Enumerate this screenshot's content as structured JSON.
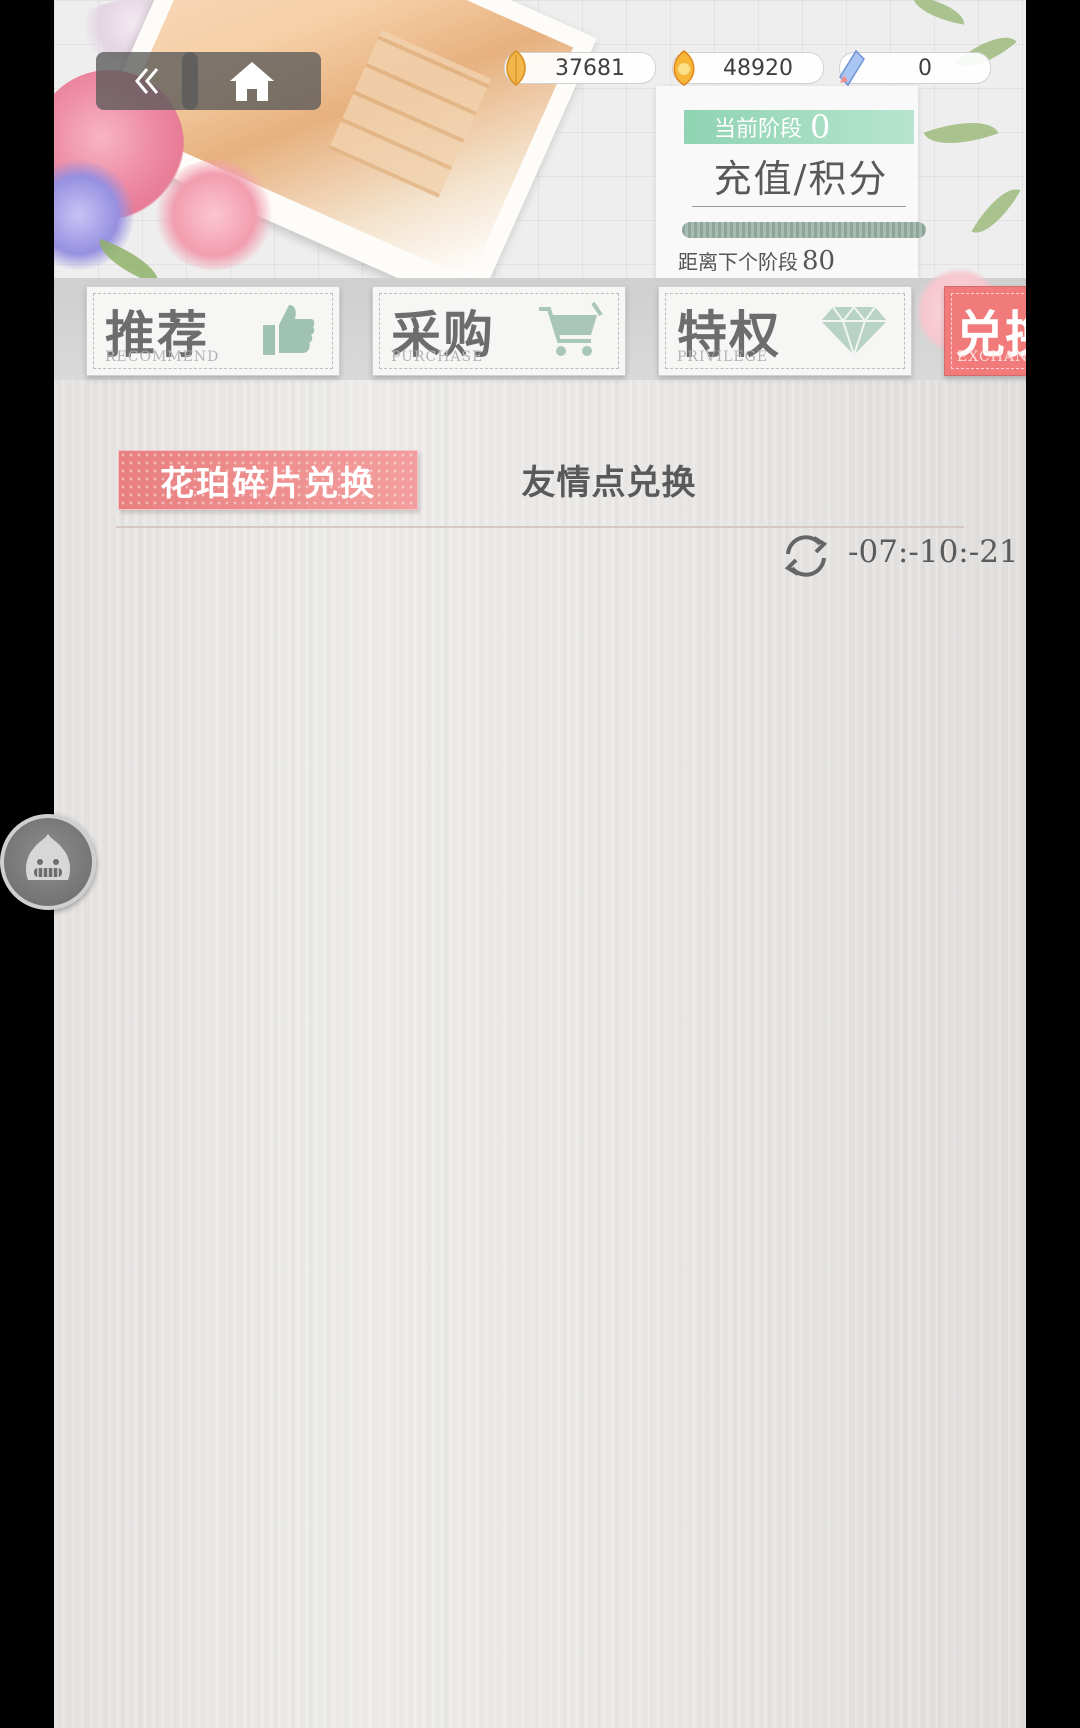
{
  "currencies": [
    {
      "icon": "amber-leaf-icon",
      "value": "37681"
    },
    {
      "icon": "gold-leaf-icon",
      "value": "48920"
    },
    {
      "icon": "blue-crystal-icon",
      "value": "0"
    }
  ],
  "stage": {
    "label": "当前阶段",
    "current": "0",
    "title": "充值/积分",
    "next_label": "距离下个阶段",
    "next_value": "80",
    "progress": 0
  },
  "nav": {
    "recommend": {
      "cn": "推荐",
      "en": "RECOMMEND"
    },
    "purchase": {
      "cn": "采购",
      "en": "PURCHASE"
    },
    "privilege": {
      "cn": "特权",
      "en": "PRIVILEGE"
    },
    "exchange": {
      "cn": "兑换",
      "en": "EXCHANGE"
    }
  },
  "subtabs": {
    "active": "花珀碎片兑换",
    "inactive": "友情点兑换"
  },
  "refresh": {
    "timer": "-07:-10:-21"
  },
  "colors": {
    "accent_pink": "#ef8585",
    "stage_green": "#8fd3b3",
    "text_gray": "#5a5a5a"
  }
}
